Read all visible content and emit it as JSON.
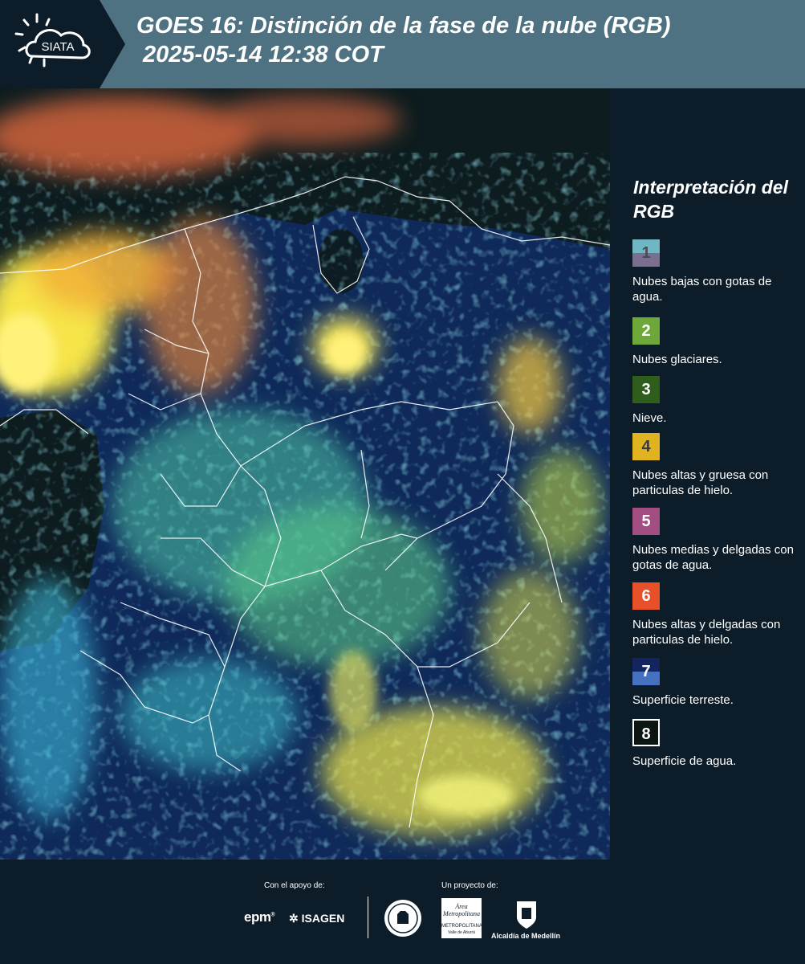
{
  "header": {
    "logo_text": "SIATA",
    "title_line1": "GOES 16: Distinción de la fase de la nube (RGB)",
    "title_line2": "2025-05-14 12:38 COT",
    "background_color": "#4e7282"
  },
  "legend": {
    "title": "Interpretación del RGB",
    "items": [
      {
        "number": "1",
        "label": "Nubes bajas con gotas de agua.",
        "color_top": "#6fb7c3",
        "color_bottom": "#7a6f8f"
      },
      {
        "number": "2",
        "label": "Nubes glaciares.",
        "color": "#6fa83a"
      },
      {
        "number": "3",
        "label": "Nieve.",
        "color": "#2f5e1c"
      },
      {
        "number": "4",
        "label": "Nubes altas y gruesa con particulas de hielo.",
        "color": "#e2b320"
      },
      {
        "number": "5",
        "label": "Nubes medias y delgadas con gotas de agua.",
        "color": "#a34e82"
      },
      {
        "number": "6",
        "label": "Nubes altas y delgadas con particulas de hielo.",
        "color": "#e8502a"
      },
      {
        "number": "7",
        "label": "Superficie terreste.",
        "color_top": "#14245e",
        "color_bottom": "#4670c0"
      },
      {
        "number": "8",
        "label": "Superficie de agua.",
        "color": "#0b1512"
      }
    ]
  },
  "footer": {
    "support_label": "Con el apoyo de:",
    "project_label": "Un proyecto de:",
    "sponsors": [
      "epm",
      "ISAGEN"
    ],
    "partners": [
      "Área Metropolitana Valle de Aburrá",
      "Alcaldía de Medellín"
    ],
    "metropolitana_text": "METROPOLITANA",
    "valle_text": "Valle de Aburrá",
    "alcaldia_text": "Alcaldía de Medellín"
  }
}
